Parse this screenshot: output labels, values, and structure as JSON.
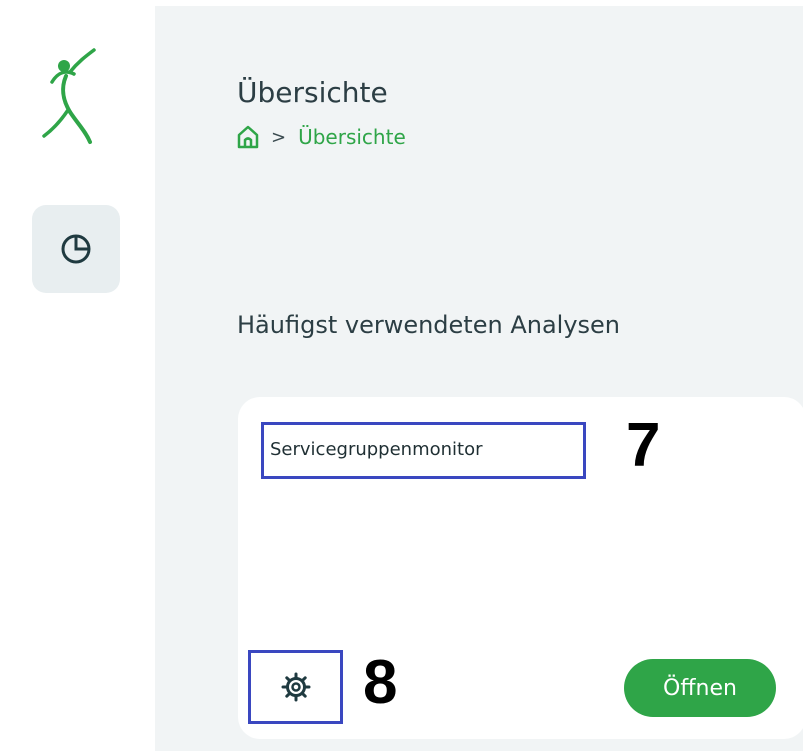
{
  "header": {
    "title": "Übersichte"
  },
  "breadcrumb": {
    "separator": ">",
    "current": "Übersichte"
  },
  "sidebar": {
    "logo_icon": "runner-logo-icon",
    "items": [
      {
        "icon": "pie-chart-icon",
        "active": true
      }
    ]
  },
  "section": {
    "title": "Häufigst verwendeten Analysen"
  },
  "card": {
    "title": "Servicegruppenmonitor",
    "settings_icon": "gear-icon",
    "open_label": "Öffnen"
  },
  "annotations": {
    "title_marker": "7",
    "settings_marker": "8",
    "box_color": "#3a47c0"
  },
  "colors": {
    "accent": "#2fa548",
    "text": "#2c3e44",
    "background": "#f1f4f5"
  }
}
